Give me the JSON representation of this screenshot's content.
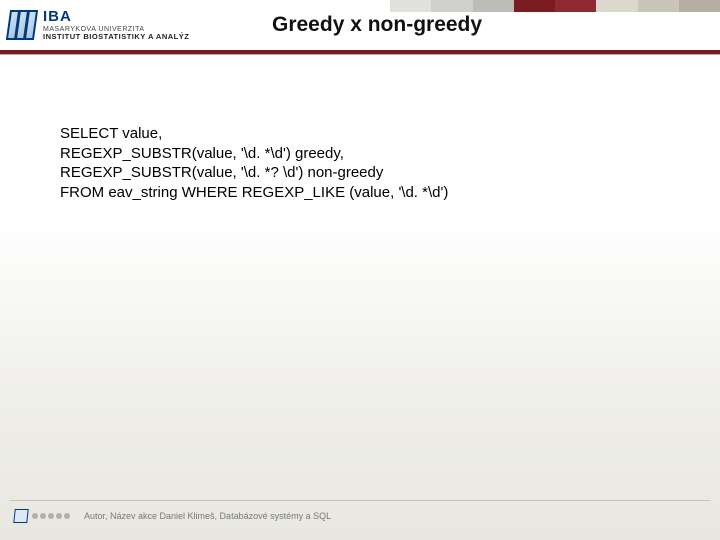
{
  "header": {
    "logo_abbr": "IBA",
    "logo_line1": "MASARYKOVA UNIVERZITA",
    "logo_line2": "INSTITUT BIOSTATISTIKY A ANALÝZ"
  },
  "slide": {
    "title": "Greedy x non-greedy"
  },
  "code": {
    "line1": "SELECT value,",
    "line2": "REGEXP_SUBSTR(value, '\\d. *\\d') greedy,",
    "line3": "REGEXP_SUBSTR(value, '\\d. *? \\d') non-greedy",
    "line4": "FROM eav_string WHERE REGEXP_LIKE (value, '\\d. *\\d')"
  },
  "footer": {
    "text": "Autor, Název akce   Daniel Klimeš, Databázové systémy a SQL"
  }
}
